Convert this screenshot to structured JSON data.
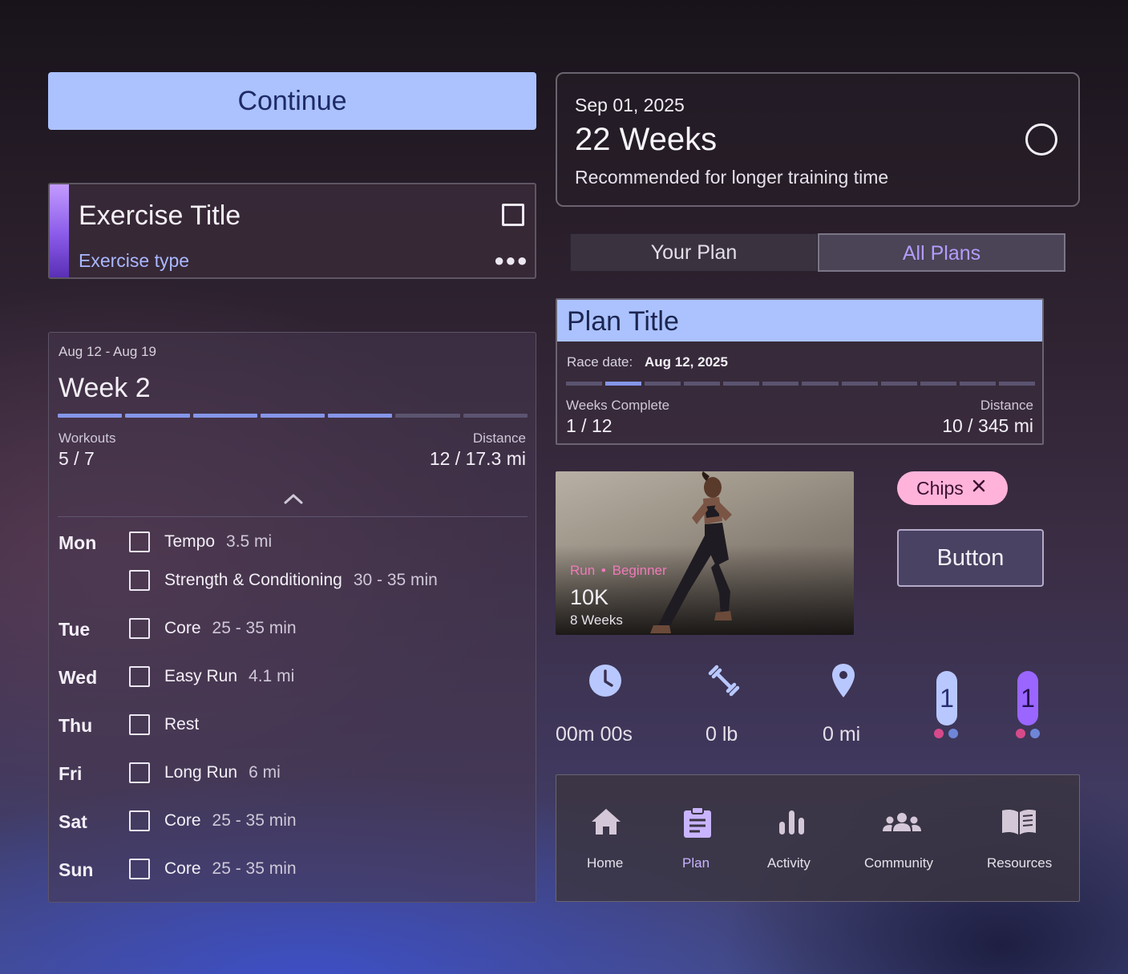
{
  "continue_button": {
    "label": "Continue"
  },
  "exercise_card": {
    "title": "Exercise Title",
    "type": "Exercise type"
  },
  "week_card": {
    "range": "Aug 12 - Aug 19",
    "title": "Week 2",
    "progress_segments_total": 7,
    "progress_segments_done": 5,
    "workouts_label": "Workouts",
    "workouts_value": "5 / 7",
    "distance_label": "Distance",
    "distance_value": "12 / 17.3 mi",
    "days": [
      {
        "day": "Mon",
        "workouts": [
          {
            "name": "Tempo",
            "detail": "3.5 mi"
          },
          {
            "name": "Strength & Conditioning",
            "detail": "30 - 35 min"
          }
        ]
      },
      {
        "day": "Tue",
        "workouts": [
          {
            "name": "Core",
            "detail": "25 - 35 min"
          }
        ]
      },
      {
        "day": "Wed",
        "workouts": [
          {
            "name": "Easy Run",
            "detail": "4.1 mi"
          }
        ]
      },
      {
        "day": "Thu",
        "workouts": [
          {
            "name": "Rest",
            "detail": ""
          }
        ]
      },
      {
        "day": "Fri",
        "workouts": [
          {
            "name": "Long Run",
            "detail": "6 mi"
          }
        ]
      },
      {
        "day": "Sat",
        "workouts": [
          {
            "name": "Core",
            "detail": "25 - 35 min"
          }
        ]
      },
      {
        "day": "Sun",
        "workouts": [
          {
            "name": "Core",
            "detail": "25 - 35 min"
          }
        ]
      }
    ]
  },
  "date_card": {
    "date": "Sep 01, 2025",
    "weeks": "22 Weeks",
    "description": "Recommended for longer training time"
  },
  "plan_tabs": {
    "your_plan": "Your Plan",
    "all_plans": "All Plans",
    "selected": "All Plans"
  },
  "plan_card": {
    "title": "Plan Title",
    "race_label": "Race date:",
    "race_date": "Aug 12, 2025",
    "progress_segments_total": 12,
    "progress_segments_done": 1,
    "weeks_label": "Weeks Complete",
    "weeks_value": "1 / 12",
    "distance_label": "Distance",
    "distance_value": "10 / 345 mi"
  },
  "run_card": {
    "type": "Run",
    "level": "Beginner",
    "separator": "•",
    "title": "10K",
    "duration": "8 Weeks"
  },
  "chip": {
    "label": "Chips"
  },
  "button": {
    "label": "Button"
  },
  "metrics": {
    "time": "00m   00s",
    "weight": "0 lb",
    "distance": "0 mi"
  },
  "pills": [
    {
      "value": "1"
    },
    {
      "value": "1"
    }
  ],
  "nav": {
    "items": [
      {
        "label": "Home",
        "icon": "home-icon"
      },
      {
        "label": "Plan",
        "icon": "clipboard-icon",
        "active": true
      },
      {
        "label": "Activity",
        "icon": "bar-chart-icon"
      },
      {
        "label": "Community",
        "icon": "people-icon"
      },
      {
        "label": "Resources",
        "icon": "book-icon"
      }
    ]
  },
  "colors": {
    "accent_blue": "#abc2ff",
    "accent_purple": "#b49cff",
    "chip_pink": "#ffb3da",
    "progress_on": "#8595e8",
    "run_meta_pink": "#f07ab8"
  }
}
